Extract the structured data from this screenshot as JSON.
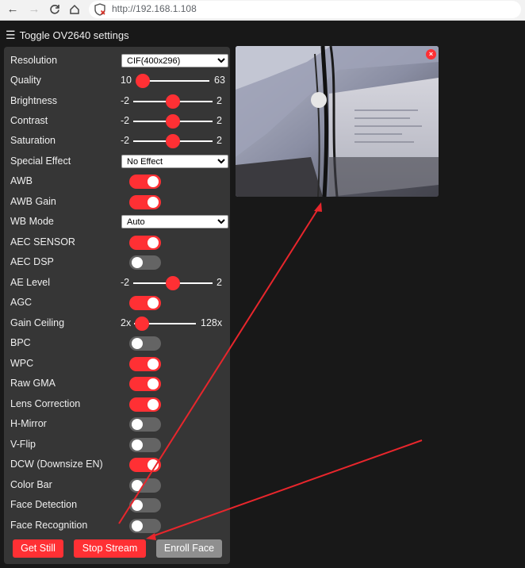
{
  "browser": {
    "url": "http://192.168.1.108",
    "back_icon": "arrow-left-icon",
    "forward_icon": "arrow-right-icon",
    "reload_icon": "reload-icon",
    "home_icon": "home-icon",
    "security_icon": "not-secure-icon"
  },
  "header": {
    "toggle_label": "Toggle OV2640 settings",
    "menu_icon": "hamburger-icon"
  },
  "settings": {
    "resolution": {
      "label": "Resolution",
      "value": "CIF(400x296)"
    },
    "quality": {
      "label": "Quality",
      "min": "10",
      "max": "63",
      "value": 10
    },
    "brightness": {
      "label": "Brightness",
      "min": "-2",
      "max": "2",
      "value": 0
    },
    "contrast": {
      "label": "Contrast",
      "min": "-2",
      "max": "2",
      "value": 0
    },
    "saturation": {
      "label": "Saturation",
      "min": "-2",
      "max": "2",
      "value": 0
    },
    "special_effect": {
      "label": "Special Effect",
      "value": "No Effect"
    },
    "awb": {
      "label": "AWB",
      "on": true
    },
    "awb_gain": {
      "label": "AWB Gain",
      "on": true
    },
    "wb_mode": {
      "label": "WB Mode",
      "value": "Auto"
    },
    "aec_sensor": {
      "label": "AEC SENSOR",
      "on": true
    },
    "aec_dsp": {
      "label": "AEC DSP",
      "on": false
    },
    "ae_level": {
      "label": "AE Level",
      "min": "-2",
      "max": "2",
      "value": 0
    },
    "agc": {
      "label": "AGC",
      "on": true
    },
    "gain_ceiling": {
      "label": "Gain Ceiling",
      "min": "2x",
      "max": "128x",
      "value": 0
    },
    "bpc": {
      "label": "BPC",
      "on": false
    },
    "wpc": {
      "label": "WPC",
      "on": true
    },
    "raw_gma": {
      "label": "Raw GMA",
      "on": true
    },
    "lens_correction": {
      "label": "Lens Correction",
      "on": true
    },
    "h_mirror": {
      "label": "H-Mirror",
      "on": false
    },
    "v_flip": {
      "label": "V-Flip",
      "on": false
    },
    "dcw": {
      "label": "DCW (Downsize EN)",
      "on": true
    },
    "color_bar": {
      "label": "Color Bar",
      "on": false
    },
    "face_detection": {
      "label": "Face Detection",
      "on": false
    },
    "face_recognition": {
      "label": "Face Recognition",
      "on": false
    }
  },
  "buttons": {
    "get_still": "Get Still",
    "stop_stream": "Stop Stream",
    "enroll_face": "Enroll Face"
  },
  "stream": {
    "close_icon": "close-icon",
    "close_glyph": "×"
  },
  "colors": {
    "accent": "#ff3034",
    "panel": "#363636",
    "background": "#181818",
    "annotation": "#e8262c"
  }
}
